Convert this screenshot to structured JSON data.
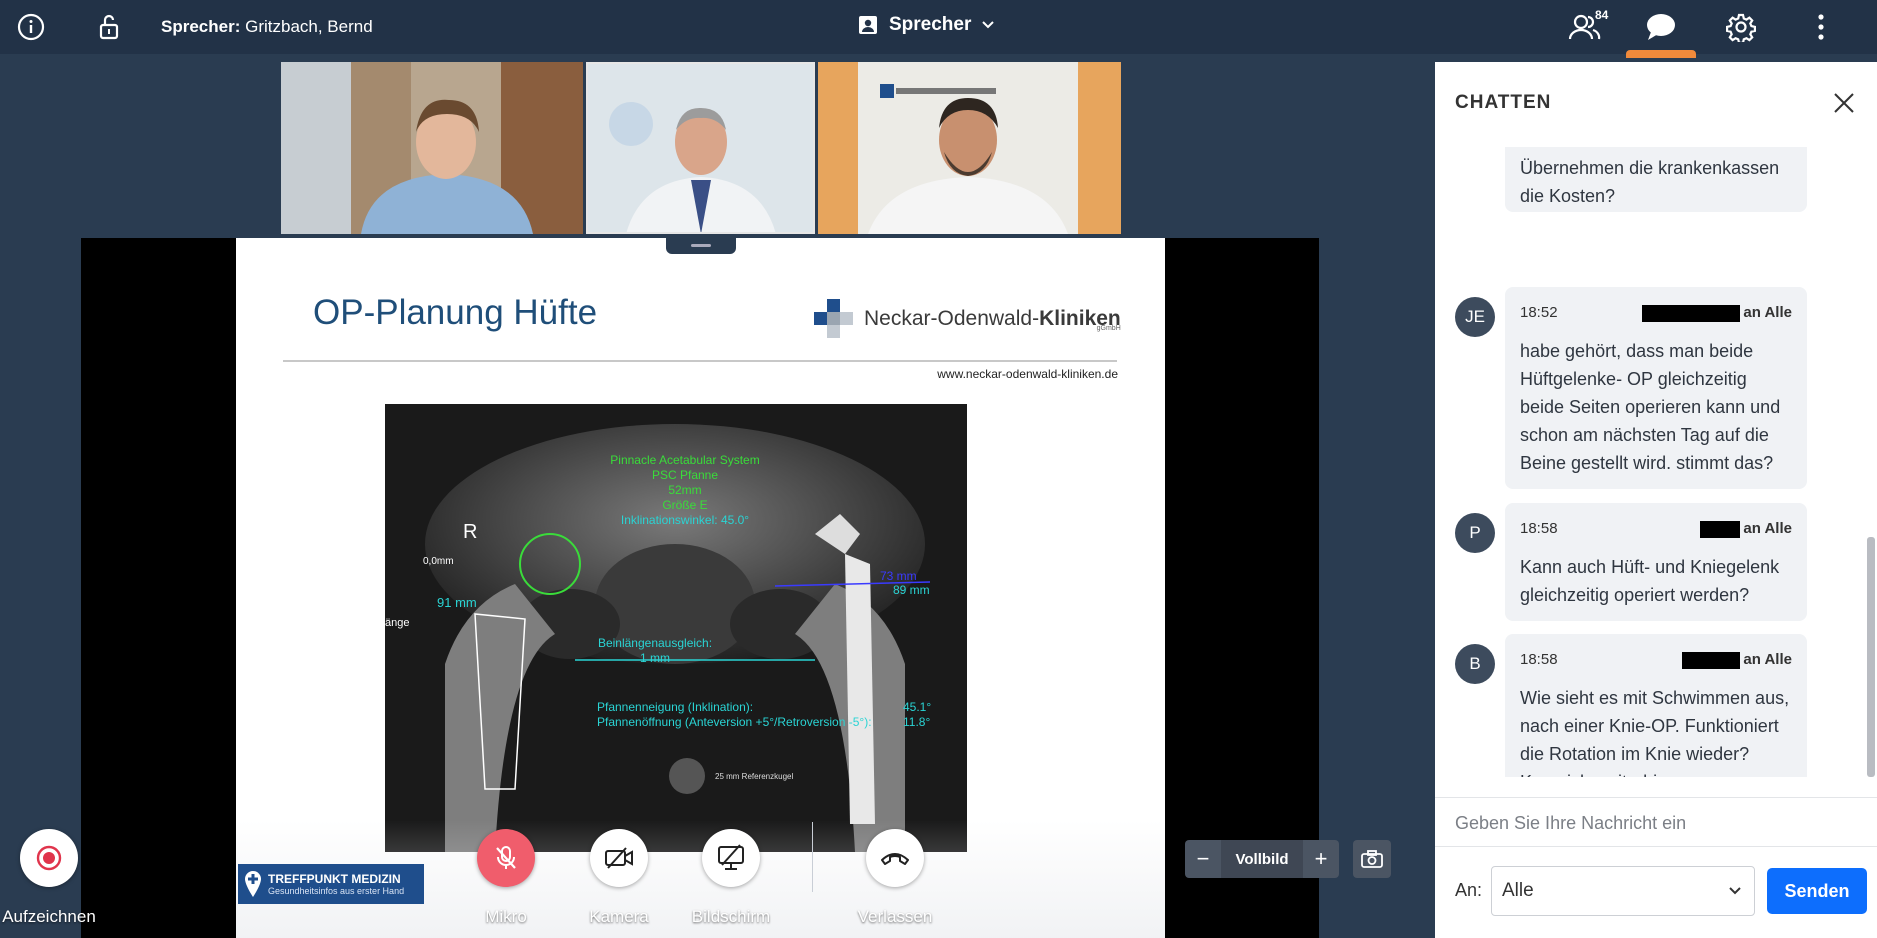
{
  "topbar": {
    "speaker_prefix": "Sprecher:",
    "speaker_name": "Gritzbach, Bernd",
    "layout_label": "Sprecher",
    "participants_count": "84"
  },
  "slide": {
    "title": "OP-Planung Hüfte",
    "brand_normal": "Neckar-Odenwald-",
    "brand_bold": "Kliniken",
    "brand_sub": "gGmbH",
    "url": "www.neckar-odenwald-kliniken.de",
    "xray_texts": {
      "side_marker": "R",
      "zero": "0,0mm",
      "left_91": "91 mm",
      "left_cut": "änge",
      "implant_lines": [
        "Pinnacle Acetabular System",
        "PSC Pfanne",
        "52mm",
        "Größe E",
        "Inklinationswinkel: 45.0°"
      ],
      "leg_length": [
        "Beinlängenausgleich:",
        "1 mm"
      ],
      "cup": [
        "Pfannenneigung (Inklination):",
        "Pfannenöffnung (Anteversion +5°/Retroversion -5°):"
      ],
      "cup_values": [
        "45.1°",
        "11.8°"
      ],
      "right_mm": [
        "73 mm",
        "89 mm"
      ],
      "ref_ball": "25 mm Referenzkugel"
    },
    "footer_logo_title": "TREFFPUNKT MEDIZIN",
    "footer_logo_sub": "Gesundheitsinfos aus erster Hand"
  },
  "controls": {
    "record": "Aufzeichnen",
    "mic": "Mikro",
    "camera": "Kamera",
    "screen": "Bildschirm",
    "leave": "Verlassen",
    "fullscreen": "Vollbild",
    "zoom_out": "−",
    "zoom_in": "+"
  },
  "colors": {
    "topbar": "#223247",
    "background": "#2a3c51",
    "mic_muted": "#f05d6c",
    "accent": "#f18a3b",
    "send": "#0d6efd"
  },
  "chat": {
    "title": "CHATTEN",
    "messages": [
      {
        "avatar": "",
        "time": "",
        "to": "",
        "text": "Übernehmen die krankenkassen die Kosten?"
      },
      {
        "avatar": "JE",
        "time": "18:52",
        "to": "an Alle",
        "text": "habe gehört, dass man beide Hüftgelenke- OP gleichzeitig beide Seiten operieren kann und schon am nächsten Tag auf die Beine gestellt wird. stimmt das?"
      },
      {
        "avatar": "P",
        "time": "18:58",
        "to": "an Alle",
        "text": "Kann auch Hüft- und Kniegelenk gleichzeitig operiert werden?"
      },
      {
        "avatar": "B",
        "time": "18:58",
        "to": "an Alle",
        "text": "Wie sieht es mit Schwimmen aus, nach einer Knie-OP. Funktioniert die Rotation im Knie wieder? Kann ich weiterhin Brustschwimmen?"
      }
    ],
    "input_placeholder": "Geben Sie Ihre Nachricht ein",
    "to_label": "An:",
    "to_value": "Alle",
    "send_label": "Senden"
  }
}
